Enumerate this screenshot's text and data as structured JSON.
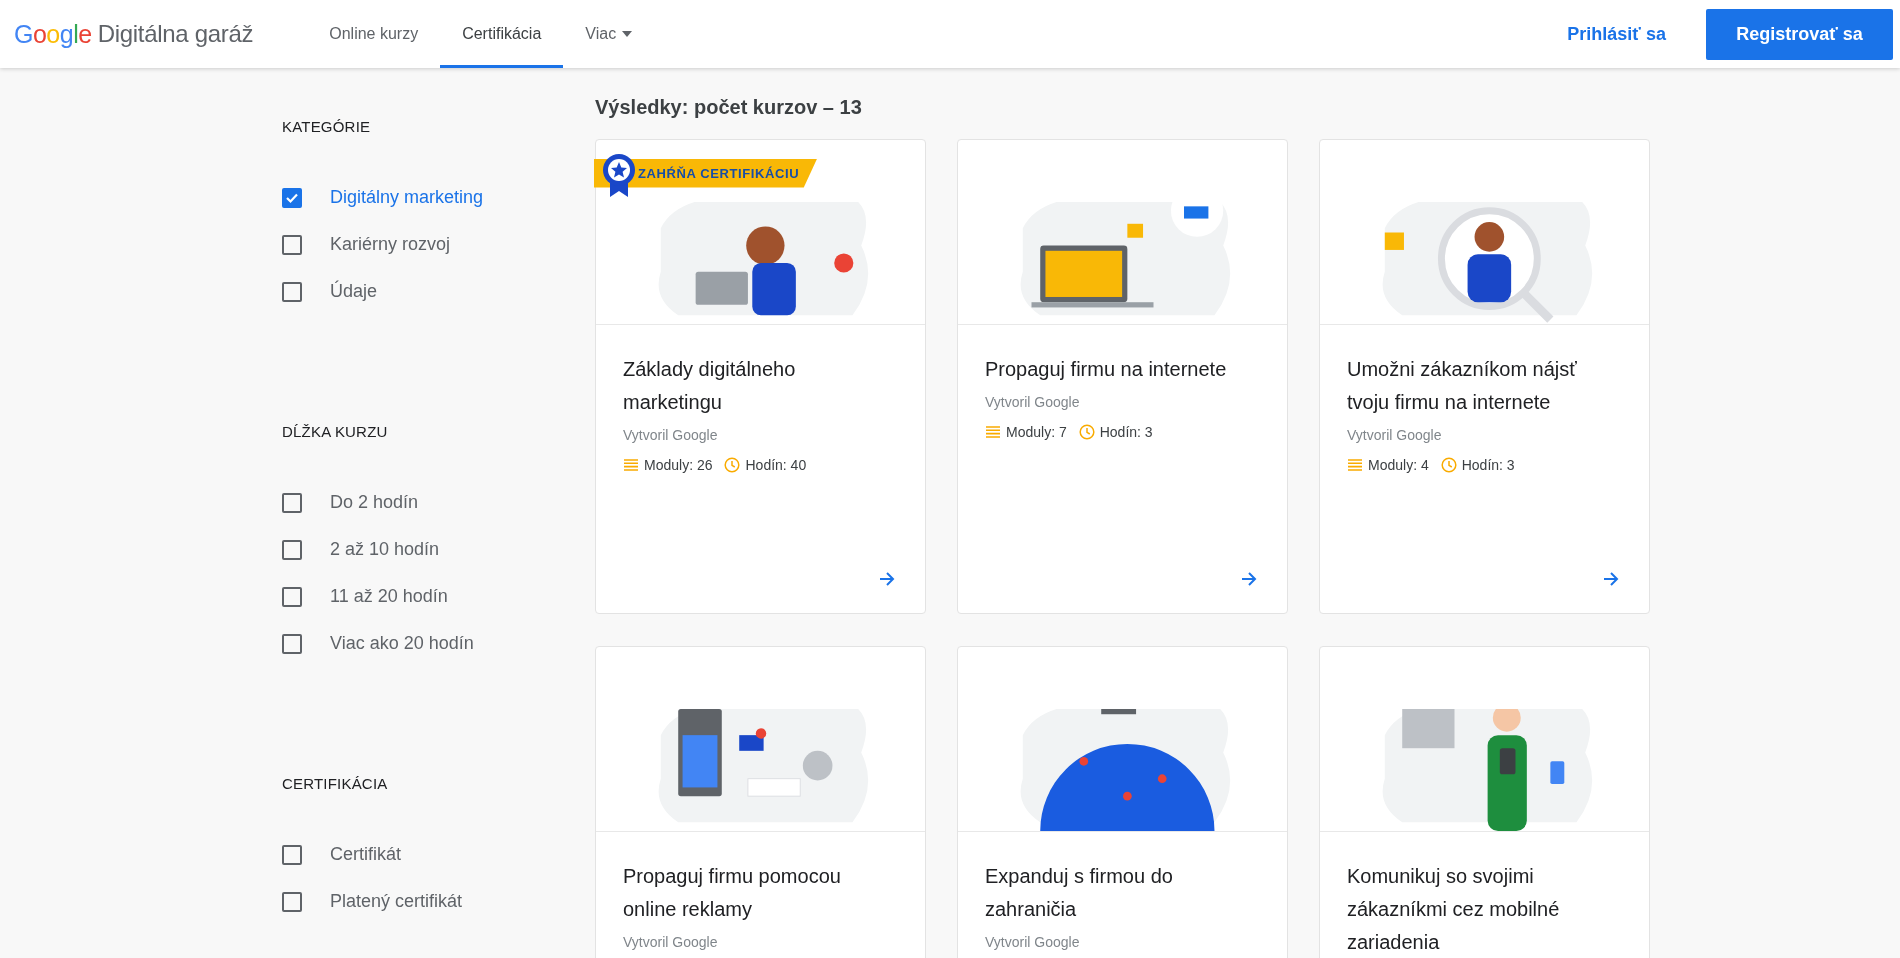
{
  "header": {
    "logo": {
      "brand": "Google",
      "product": "Digitálna garáž"
    },
    "nav": [
      {
        "label": "Online kurzy",
        "selected": false,
        "has_menu": false
      },
      {
        "label": "Certifikácia",
        "selected": true,
        "has_menu": false
      },
      {
        "label": "Viac",
        "selected": false,
        "has_menu": true
      }
    ],
    "sign_in": "Prihlásiť sa",
    "register": "Registrovať sa"
  },
  "sidebar": {
    "sections": [
      {
        "title": "KATEGÓRIE",
        "options": [
          {
            "label": "Digitálny marketing",
            "checked": true
          },
          {
            "label": "Kariérny rozvoj",
            "checked": false
          },
          {
            "label": "Údaje",
            "checked": false
          }
        ]
      },
      {
        "title": "DĹŽKA KURZU",
        "options": [
          {
            "label": "Do 2 hodín",
            "checked": false
          },
          {
            "label": "2 až 10 hodín",
            "checked": false
          },
          {
            "label": "11 až 20 hodín",
            "checked": false
          },
          {
            "label": "Viac ako 20 hodín",
            "checked": false
          }
        ]
      },
      {
        "title": "CERTIFIKÁCIA",
        "options": [
          {
            "label": "Certifikát",
            "checked": false
          },
          {
            "label": "Platený certifikát",
            "checked": false
          }
        ]
      }
    ]
  },
  "results": {
    "heading": "Výsledky: počet kurzov – 13",
    "courses": [
      {
        "badge": "ZAHŔŇA CERTIFIKÁCIU",
        "title": "Základy digitálneho marketingu",
        "author": "Vytvoril Google",
        "modules": "Moduly: 26",
        "hours": "Hodín: 40"
      },
      {
        "title": "Propaguj firmu na internete",
        "author": "Vytvoril Google",
        "modules": "Moduly: 7",
        "hours": "Hodín: 3"
      },
      {
        "title": "Umožni zákazníkom nájsť tvoju firmu na internete",
        "author": "Vytvoril Google",
        "modules": "Moduly: 4",
        "hours": "Hodín: 3"
      },
      {
        "title": "Propaguj firmu pomocou online reklamy",
        "author": "Vytvoril Google"
      },
      {
        "title": "Expanduj s firmou do zahraničia",
        "author": "Vytvoril Google"
      },
      {
        "title": "Komunikuj so svojimi zákazníkmi cez mobilné zariadenia"
      }
    ]
  }
}
